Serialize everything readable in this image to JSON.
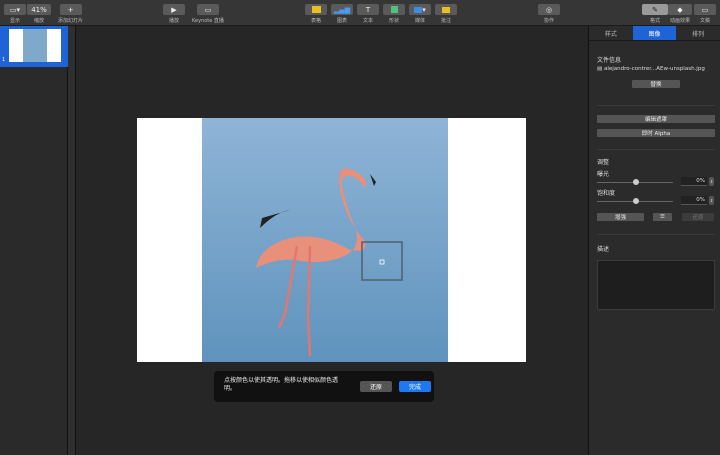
{
  "toolbar": {
    "view": "显示",
    "zoom": "缩放",
    "zoom_value": "41%",
    "add_slide": "添加幻灯片",
    "play": "播放",
    "keynote_live": "Keynote 直播",
    "table": "表格",
    "chart": "图表",
    "text": "文本",
    "shape": "形状",
    "media": "媒体",
    "comment": "批注",
    "collaborate": "协作",
    "format": "格式",
    "animate": "动画效果",
    "document": "文稿"
  },
  "navigator": {
    "slide_number": "1"
  },
  "dialog": {
    "message": "点按颜色以使其透明。拖移以使相似颜色透明。",
    "revert": "还原",
    "done": "完成"
  },
  "panel": {
    "tabs": [
      "样式",
      "图像",
      "排列"
    ],
    "active_tab": "图像",
    "file_info": "文件信息",
    "file_name": "alejandro-contrer...AEw-unsplash.jpg",
    "replace": "替换",
    "edit_mask": "编辑遮罩",
    "instant_alpha": "即时 Alpha",
    "adjust": "调整",
    "exposure": "曝光",
    "exposure_value": "0%",
    "saturation": "饱和度",
    "saturation_value": "0%",
    "enhance": "增强",
    "reset": "还原",
    "description": "描述"
  },
  "colors": {
    "accent": "#1e64d6"
  }
}
